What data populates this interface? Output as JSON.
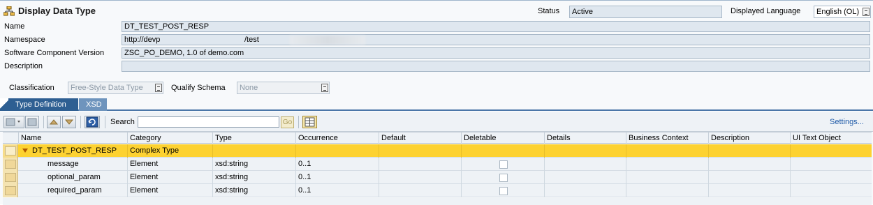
{
  "header": {
    "title": "Display Data Type",
    "status_label": "Status",
    "status_value": "Active",
    "language_label": "Displayed Language",
    "language_value": "English (OL)"
  },
  "fields": {
    "name_label": "Name",
    "name_value": "DT_TEST_POST_RESP",
    "namespace_label": "Namespace",
    "namespace_prefix": "http://devp",
    "namespace_suffix": "/test",
    "scv_label": "Software Component Version",
    "scv_value": "ZSC_PO_DEMO, 1.0 of demo.com",
    "description_label": "Description",
    "description_value": ""
  },
  "classification": {
    "label": "Classification",
    "value": "Free-Style Data Type",
    "qualify_label": "Qualify Schema",
    "qualify_value": "None"
  },
  "tabs": [
    {
      "label": "Type Definition",
      "active": true
    },
    {
      "label": "XSD",
      "active": false
    }
  ],
  "toolbar": {
    "search_label": "Search",
    "search_value": "",
    "go_label": "Go",
    "settings_label": "Settings..."
  },
  "table": {
    "columns": [
      "Name",
      "Category",
      "Type",
      "Occurrence",
      "Default",
      "Deletable",
      "Details",
      "Business Context",
      "Description",
      "UI Text Object"
    ],
    "rows": [
      {
        "name": "DT_TEST_POST_RESP",
        "category": "Complex Type",
        "type": "",
        "occurrence": "",
        "selected": true
      },
      {
        "name": "message",
        "category": "Element",
        "type": "xsd:string",
        "occurrence": "0..1",
        "selected": false
      },
      {
        "name": "optional_param",
        "category": "Element",
        "type": "xsd:string",
        "occurrence": "0..1",
        "selected": false
      },
      {
        "name": "required_param",
        "category": "Element",
        "type": "xsd:string",
        "occurrence": "0..1",
        "selected": false
      }
    ]
  },
  "colors": {
    "tab_active": "#2e5f92",
    "tab_inactive": "#6e94bd",
    "row_selected": "#fdd231",
    "link": "#1e5aa8"
  }
}
